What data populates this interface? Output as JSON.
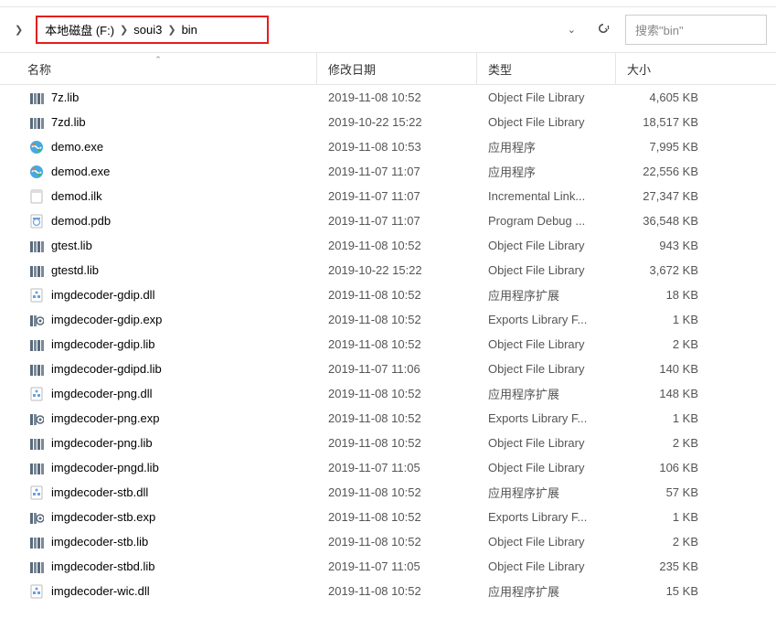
{
  "breadcrumb": {
    "items": [
      "本地磁盘 (F:)",
      "soui3",
      "bin"
    ]
  },
  "search": {
    "placeholder": "搜索\"bin\""
  },
  "columns": {
    "name": "名称",
    "date": "修改日期",
    "type": "类型",
    "size": "大小"
  },
  "files": [
    {
      "name": "7z.lib",
      "date": "2019-11-08 10:52",
      "type": "Object File Library",
      "size": "4,605 KB",
      "icon": "lib"
    },
    {
      "name": "7zd.lib",
      "date": "2019-10-22 15:22",
      "type": "Object File Library",
      "size": "18,517 KB",
      "icon": "lib"
    },
    {
      "name": "demo.exe",
      "date": "2019-11-08 10:53",
      "type": "应用程序",
      "size": "7,995 KB",
      "icon": "exe"
    },
    {
      "name": "demod.exe",
      "date": "2019-11-07 11:07",
      "type": "应用程序",
      "size": "22,556 KB",
      "icon": "exe"
    },
    {
      "name": "demod.ilk",
      "date": "2019-11-07 11:07",
      "type": "Incremental Link...",
      "size": "27,347 KB",
      "icon": "ilk"
    },
    {
      "name": "demod.pdb",
      "date": "2019-11-07 11:07",
      "type": "Program Debug ...",
      "size": "36,548 KB",
      "icon": "pdb"
    },
    {
      "name": "gtest.lib",
      "date": "2019-11-08 10:52",
      "type": "Object File Library",
      "size": "943 KB",
      "icon": "lib"
    },
    {
      "name": "gtestd.lib",
      "date": "2019-10-22 15:22",
      "type": "Object File Library",
      "size": "3,672 KB",
      "icon": "lib"
    },
    {
      "name": "imgdecoder-gdip.dll",
      "date": "2019-11-08 10:52",
      "type": "应用程序扩展",
      "size": "18 KB",
      "icon": "dll"
    },
    {
      "name": "imgdecoder-gdip.exp",
      "date": "2019-11-08 10:52",
      "type": "Exports Library F...",
      "size": "1 KB",
      "icon": "exp"
    },
    {
      "name": "imgdecoder-gdip.lib",
      "date": "2019-11-08 10:52",
      "type": "Object File Library",
      "size": "2 KB",
      "icon": "lib"
    },
    {
      "name": "imgdecoder-gdipd.lib",
      "date": "2019-11-07 11:06",
      "type": "Object File Library",
      "size": "140 KB",
      "icon": "lib"
    },
    {
      "name": "imgdecoder-png.dll",
      "date": "2019-11-08 10:52",
      "type": "应用程序扩展",
      "size": "148 KB",
      "icon": "dll"
    },
    {
      "name": "imgdecoder-png.exp",
      "date": "2019-11-08 10:52",
      "type": "Exports Library F...",
      "size": "1 KB",
      "icon": "exp"
    },
    {
      "name": "imgdecoder-png.lib",
      "date": "2019-11-08 10:52",
      "type": "Object File Library",
      "size": "2 KB",
      "icon": "lib"
    },
    {
      "name": "imgdecoder-pngd.lib",
      "date": "2019-11-07 11:05",
      "type": "Object File Library",
      "size": "106 KB",
      "icon": "lib"
    },
    {
      "name": "imgdecoder-stb.dll",
      "date": "2019-11-08 10:52",
      "type": "应用程序扩展",
      "size": "57 KB",
      "icon": "dll"
    },
    {
      "name": "imgdecoder-stb.exp",
      "date": "2019-11-08 10:52",
      "type": "Exports Library F...",
      "size": "1 KB",
      "icon": "exp"
    },
    {
      "name": "imgdecoder-stb.lib",
      "date": "2019-11-08 10:52",
      "type": "Object File Library",
      "size": "2 KB",
      "icon": "lib"
    },
    {
      "name": "imgdecoder-stbd.lib",
      "date": "2019-11-07 11:05",
      "type": "Object File Library",
      "size": "235 KB",
      "icon": "lib"
    },
    {
      "name": "imgdecoder-wic.dll",
      "date": "2019-11-08 10:52",
      "type": "应用程序扩展",
      "size": "15 KB",
      "icon": "dll"
    }
  ]
}
